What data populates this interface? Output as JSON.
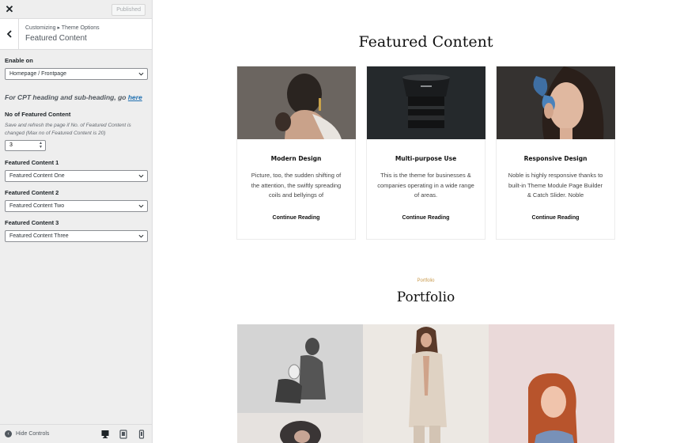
{
  "sidebar": {
    "close_icon": "close-icon",
    "publish_label": "Published",
    "breadcrumb": "Customizing ▸ Theme Options",
    "section_title": "Featured Content",
    "enable_on": {
      "label": "Enable on",
      "value": "Homepage / Frontpage"
    },
    "note": {
      "text": "For CPT heading and sub-heading, go ",
      "link": "here"
    },
    "count": {
      "label": "No of Featured Content",
      "description": "Save and refresh the page if No. of Featured Content is changed (Max no of Featured Content is 20)",
      "value": "3"
    },
    "items": [
      {
        "label": "Featured Content 1",
        "value": "Featured Content One"
      },
      {
        "label": "Featured Content 2",
        "value": "Featured Content Two"
      },
      {
        "label": "Featured Content 3",
        "value": "Featured Content Three"
      }
    ],
    "footer": {
      "hide_label": "Hide Controls"
    }
  },
  "preview": {
    "featured_title": "Featured Content",
    "cards": [
      {
        "title": "Modern Design",
        "text": "Picture, too, the sudden shifting of the attention, the swiftly spreading coils and bellyings of",
        "link": "Continue Reading"
      },
      {
        "title": "Multi-purpose Use",
        "text": "This is the theme for businesses & companies operating in a wide range of areas.",
        "link": "Continue Reading"
      },
      {
        "title": "Responsive Design",
        "text": "Noble is highly responsive thanks to built-in Theme Module Page Builder & Catch Slider. Noble",
        "link": "Continue Reading"
      }
    ],
    "portfolio_kicker": "Portfolio",
    "portfolio_title": "Portfolio"
  },
  "colors": {
    "link": "#2271b1",
    "accent": "#c99a4c",
    "sidebar_bg": "#eeeeee"
  }
}
